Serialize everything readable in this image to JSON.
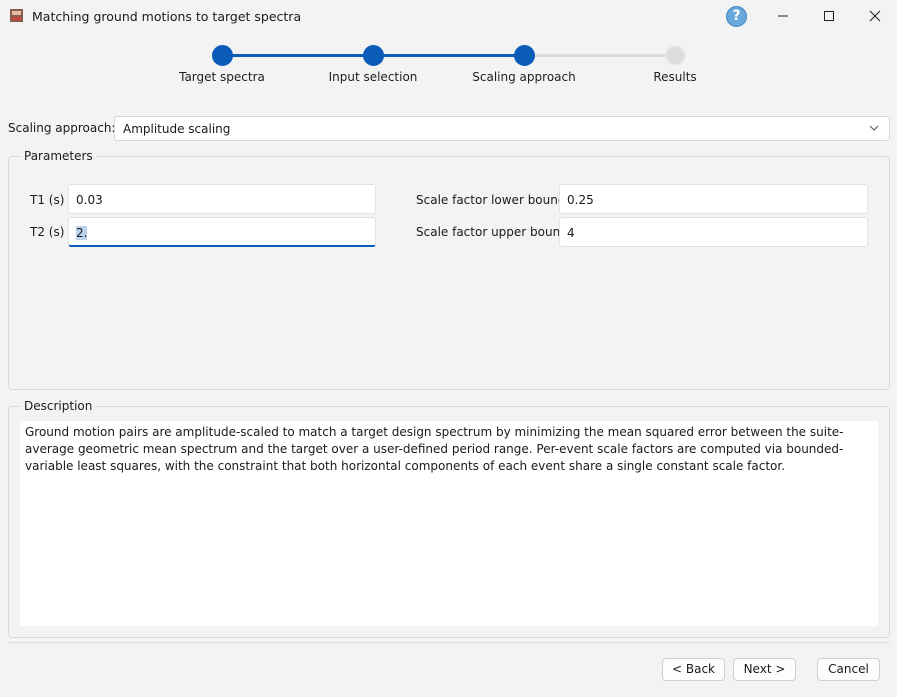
{
  "window": {
    "title": "Matching ground motions to target spectra",
    "help_glyph": "?"
  },
  "steps": [
    {
      "label": "Target spectra",
      "state": "done"
    },
    {
      "label": "Input selection",
      "state": "done"
    },
    {
      "label": "Scaling approach",
      "state": "done"
    },
    {
      "label": "Results",
      "state": "todo"
    }
  ],
  "scaling": {
    "label": "Scaling approach:",
    "value": "Amplitude scaling"
  },
  "parameters": {
    "title": "Parameters",
    "t1": {
      "label": "T1 (s)",
      "value": "0.03"
    },
    "t2": {
      "label": "T2 (s)",
      "value": "2."
    },
    "sf_lower": {
      "label": "Scale factor lower bound",
      "value": "0.25"
    },
    "sf_upper": {
      "label": "Scale factor upper bound",
      "value": "4"
    }
  },
  "description": {
    "title": "Description",
    "text": "Ground motion pairs are amplitude-scaled to match a target design spectrum by minimizing the mean squared error between the suite-average geometric mean spectrum and the target over a user-defined period range. Per-event scale factors are computed via bounded-variable least squares, with the constraint that both horizontal components of each event share a single constant scale factor."
  },
  "buttons": {
    "back": "< Back",
    "next": "Next >",
    "cancel": "Cancel"
  },
  "colors": {
    "accent": "#0b5cb8",
    "pending": "#dcdcdc",
    "help": "#6aa8da"
  }
}
